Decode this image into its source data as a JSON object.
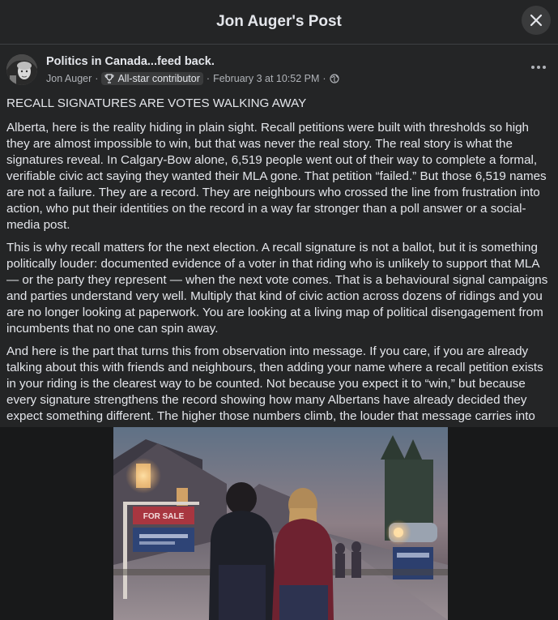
{
  "header": {
    "title": "Jon Auger's Post"
  },
  "post": {
    "group_name": "Politics in Canada...feed back.",
    "author": "Jon Auger",
    "separator": "·",
    "badge": "All-star contributor",
    "timestamp": "February 3 at 10:52 PM",
    "headline": "RECALL SIGNATURES ARE VOTES WALKING AWAY",
    "paragraphs": [
      "Alberta, here is the reality hiding in plain sight. Recall petitions were built with thresholds so high they are almost impossible to win, but that was never the real story. The real story is what the signatures reveal. In Calgary-Bow alone, 6,519 people went out of their way to complete a formal, verifiable civic act saying they wanted their MLA gone. That petition “failed.” But those 6,519 names are not a failure. They are a record. They are neighbours who crossed the line from frustration into action, who put their identities on the record in a way far stronger than a poll answer or a social-media post.",
      "This is why recall matters for the next election. A recall signature is not a ballot, but it is something politically louder: documented evidence of a voter in that riding who is unlikely to support that MLA — or the party they represent — when the next vote comes. That is a behavioural signal campaigns and parties understand very well. Multiply that kind of civic action across dozens of ridings and you are no longer looking at paperwork. You are looking at a living map of political disengagement from incumbents that no one can spin away.",
      "And here is the part that turns this from observation into message. If you care, if you are already talking about this with friends and neighbours, then adding your name where a recall petition exists in your riding is the clearest way to be counted. Not because you expect it to “win,” but because every signature strengthens the record showing how many Albertans have already decided they expect something different. The higher those numbers climb, the louder that message carries into every campaign office, every doorstep conversation, and every ballot box in the next election."
    ],
    "photo_sign_text": "FOR SALE"
  },
  "icons": {
    "close": "close-icon",
    "trophy": "trophy-icon",
    "globe": "globe-icon",
    "more": "more-horizontal-icon"
  },
  "colors": {
    "background": "#242526",
    "text": "#e4e6eb",
    "secondary_text": "#b0b3b8",
    "button": "#3a3b3c"
  }
}
